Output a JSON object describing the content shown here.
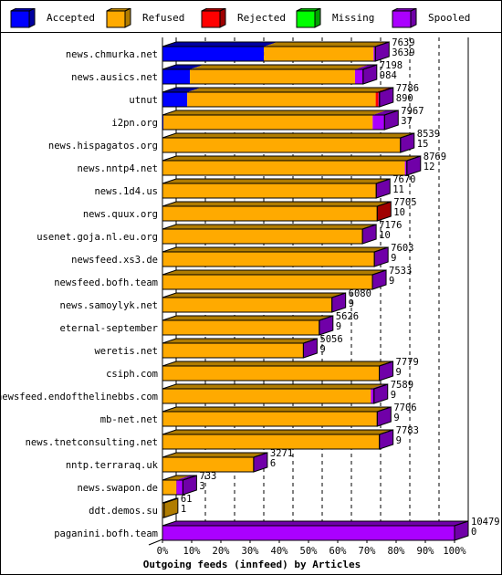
{
  "chart_data": {
    "type": "bar",
    "orientation": "horizontal",
    "stacked": true,
    "three_d": true,
    "title": "Outgoing feeds (innfeed) by Articles",
    "xlabel": "Outgoing feeds (innfeed) by Articles",
    "ylabel": "",
    "xlim": [
      0,
      100
    ],
    "x_unit": "percent of max total (10479)",
    "x_ticks": [
      "0%",
      "10%",
      "20%",
      "30%",
      "40%",
      "50%",
      "60%",
      "70%",
      "80%",
      "90%",
      "100%"
    ],
    "grid": "dashed vertical",
    "legend_position": "top",
    "legend": [
      {
        "name": "Accepted",
        "color": "#0000ff",
        "side": "#0000a0"
      },
      {
        "name": "Refused",
        "color": "#ffaa00",
        "side": "#b07c00"
      },
      {
        "name": "Rejected",
        "color": "#ff0000",
        "side": "#a00000"
      },
      {
        "name": "Missing",
        "color": "#00ff00",
        "side": "#00a000"
      },
      {
        "name": "Spooled",
        "color": "#aa00ff",
        "side": "#7000a8"
      }
    ],
    "categories": [
      "news.chmurka.net",
      "news.ausics.net",
      "utnut",
      "i2pn.org",
      "news.hispagatos.org",
      "news.nntp4.net",
      "news.1d4.us",
      "news.quux.org",
      "usenet.goja.nl.eu.org",
      "newsfeed.xs3.de",
      "newsfeed.bofh.team",
      "news.samoylyk.net",
      "eternal-september",
      "weretis.net",
      "csiph.com",
      "newsfeed.endofthelinebbs.com",
      "mb-net.net",
      "news.tnetconsulting.net",
      "nntp.terraraq.uk",
      "news.swapon.de",
      "ddt.demos.su",
      "paganini.bofh.team"
    ],
    "totals": [
      7639,
      7198,
      7786,
      7967,
      8539,
      8769,
      7670,
      7705,
      7176,
      7603,
      7533,
      6080,
      5626,
      5056,
      7779,
      7589,
      7706,
      7783,
      3271,
      733,
      61,
      10479
    ],
    "accepted_labels": [
      3639,
      984,
      890,
      37,
      15,
      12,
      11,
      10,
      10,
      9,
      9,
      9,
      9,
      9,
      9,
      9,
      9,
      9,
      6,
      3,
      1,
      0
    ],
    "series": [
      {
        "name": "Accepted",
        "values": [
          3639,
          984,
          890,
          37,
          15,
          12,
          11,
          10,
          10,
          9,
          9,
          9,
          9,
          9,
          9,
          9,
          9,
          9,
          6,
          3,
          1,
          0
        ]
      },
      {
        "name": "Refused",
        "values": [
          3935,
          5924,
          6760,
          7505,
          8500,
          8687,
          7645,
          7680,
          7157,
          7579,
          7509,
          6056,
          5602,
          5037,
          7755,
          7470,
          7682,
          7759,
          3255,
          500,
          60,
          0
        ]
      },
      {
        "name": "Rejected",
        "values": [
          0,
          0,
          100,
          0,
          0,
          0,
          0,
          15,
          0,
          0,
          0,
          0,
          0,
          0,
          0,
          0,
          0,
          0,
          0,
          0,
          0,
          0
        ]
      },
      {
        "name": "Missing",
        "values": [
          0,
          0,
          0,
          0,
          0,
          0,
          0,
          0,
          0,
          0,
          0,
          0,
          0,
          0,
          0,
          0,
          0,
          0,
          0,
          0,
          0,
          0
        ]
      },
      {
        "name": "Spooled",
        "values": [
          65,
          290,
          36,
          425,
          24,
          70,
          14,
          0,
          9,
          15,
          15,
          15,
          15,
          10,
          15,
          110,
          15,
          15,
          10,
          230,
          0,
          10479
        ]
      }
    ]
  }
}
